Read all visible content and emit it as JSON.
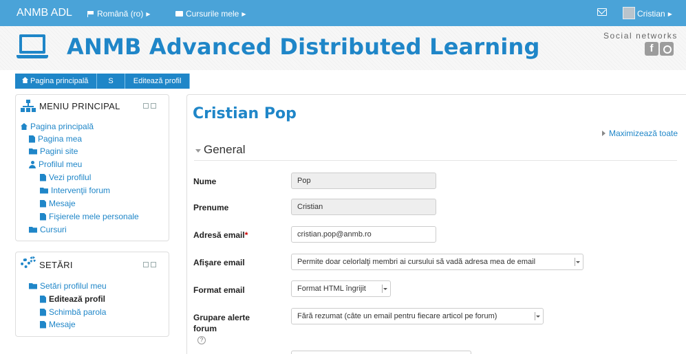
{
  "navbar": {
    "brand": "ANMB ADL",
    "language": "Română (ro)",
    "my_courses": "Cursurile mele",
    "user": "Cristian"
  },
  "header": {
    "site_title": "ANMB Advanced Distributed Learning",
    "social_label": "Social networks",
    "facebook_glyph": "f"
  },
  "breadcrumb": [
    "Pagina principală",
    "S",
    "Editează profil"
  ],
  "menu_block": {
    "title": "MENIU PRINCIPAL",
    "items": [
      "Pagina principală",
      "Pagina mea",
      "Pagini site",
      "Profilul meu",
      "Vezi profilul",
      "Intervenţii forum",
      "Mesaje",
      "Fişierele mele personale",
      "Cursuri"
    ]
  },
  "settings_block": {
    "title": "SETĂRI",
    "items": [
      "Setări profilul meu",
      "Editează profil",
      "Schimbă parola",
      "Mesaje"
    ]
  },
  "main": {
    "user_name": "Cristian Pop",
    "maximize_all": "Maximizează toate",
    "section_title": "General",
    "fields": {
      "surname": {
        "label": "Nume",
        "value": "Pop"
      },
      "firstname": {
        "label": "Prenume",
        "value": "Cristian"
      },
      "email": {
        "label": "Adresă email",
        "required_mark": "*",
        "value": "cristian.pop@anmb.ro"
      },
      "email_display": {
        "label": "Afişare email",
        "value": "Permite doar celorlalţi membri ai cursului să vadă adresa mea de email"
      },
      "email_format": {
        "label": "Format email",
        "value": "Format HTML îngrijit"
      },
      "forum_digest": {
        "label_line1": "Grupare alerte",
        "label_line2": "forum",
        "value": "Fără rezumat (câte un email pentru fiecare articol pe forum)"
      }
    },
    "help_glyph": "?"
  },
  "colors": {
    "navbar": "#4aa3d8",
    "accent": "#1f86c8"
  }
}
